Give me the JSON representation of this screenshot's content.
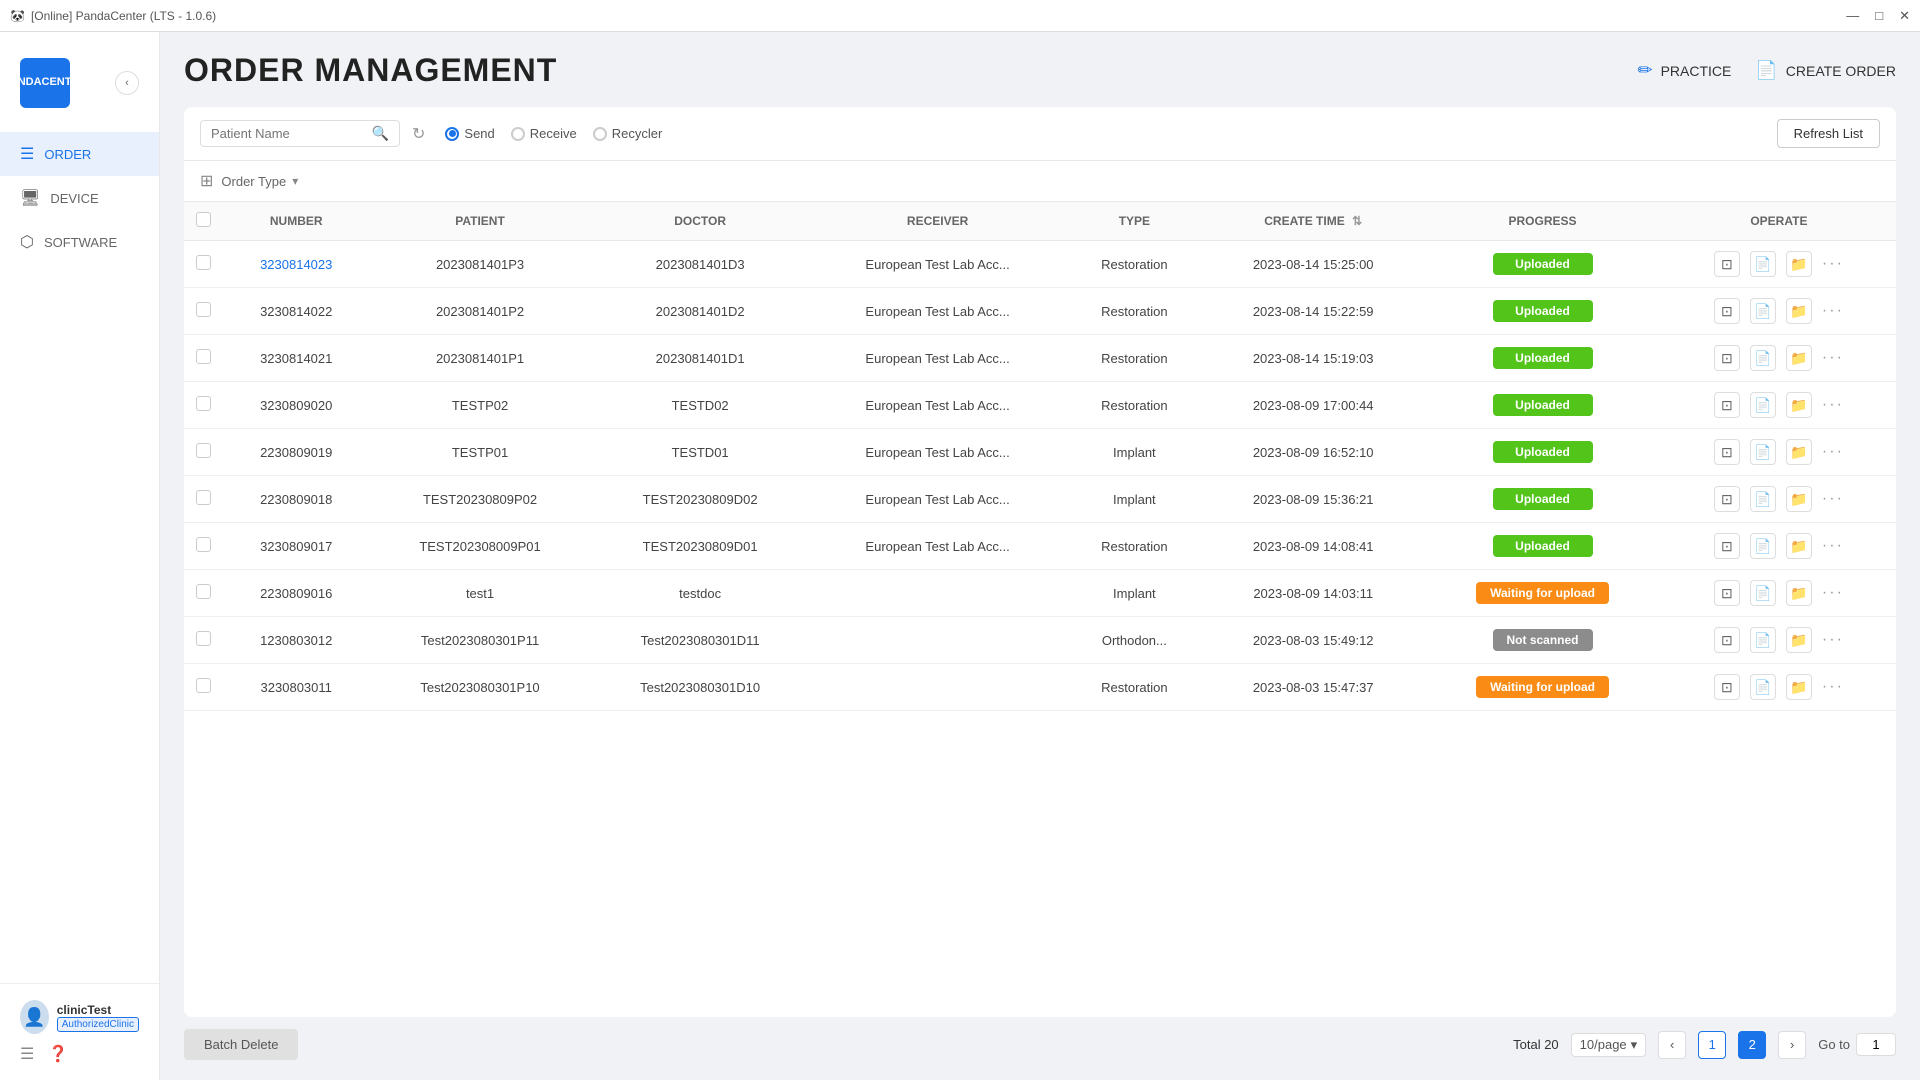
{
  "titlebar": {
    "title": "[Online] PandaCenter (LTS - 1.0.6)",
    "icon": "🐼",
    "buttons": [
      "–",
      "□",
      "✕"
    ]
  },
  "sidebar": {
    "logo": {
      "line1": "PANDA",
      "line2": "CENTER"
    },
    "nav_items": [
      {
        "id": "order",
        "label": "ORDER",
        "icon": "☰",
        "active": true
      },
      {
        "id": "device",
        "label": "DEVICE",
        "icon": "💻",
        "active": false
      },
      {
        "id": "software",
        "label": "SOFTWARE",
        "icon": "⬡",
        "active": false
      }
    ],
    "user": {
      "name": "clinicTest",
      "role": "AuthorizedClinic"
    }
  },
  "header": {
    "title": "ORDER MANAGEMENT",
    "actions": [
      {
        "id": "practice",
        "label": "PRACTICE",
        "icon": "✏"
      },
      {
        "id": "create-order",
        "label": "CREATE ORDER",
        "icon": "📄"
      }
    ]
  },
  "toolbar": {
    "search_placeholder": "Patient Name",
    "radio_options": [
      {
        "id": "send",
        "label": "Send",
        "checked": true
      },
      {
        "id": "receive",
        "label": "Receive",
        "checked": false
      },
      {
        "id": "recycler",
        "label": "Recycler",
        "checked": false
      }
    ],
    "refresh_list_label": "Refresh List",
    "order_type_label": "Order Type"
  },
  "table": {
    "columns": [
      {
        "id": "checkbox",
        "label": ""
      },
      {
        "id": "number",
        "label": "NUMBER"
      },
      {
        "id": "patient",
        "label": "PATIENT"
      },
      {
        "id": "doctor",
        "label": "DOCTOR"
      },
      {
        "id": "receiver",
        "label": "RECEIVER"
      },
      {
        "id": "type",
        "label": "TYPE"
      },
      {
        "id": "create_time",
        "label": "CREATE TIME",
        "sortable": true
      },
      {
        "id": "progress",
        "label": "PROGRESS"
      },
      {
        "id": "operate",
        "label": "OPERATE"
      }
    ],
    "rows": [
      {
        "id": 1,
        "number": "3230814023",
        "patient": "2023081401P3",
        "doctor": "2023081401D3",
        "receiver": "European Test Lab Acc...",
        "type": "Restoration",
        "create_time": "2023-08-14 15:25:00",
        "progress": "Uploaded",
        "progress_type": "uploaded",
        "link": true
      },
      {
        "id": 2,
        "number": "3230814022",
        "patient": "2023081401P2",
        "doctor": "2023081401D2",
        "receiver": "European Test Lab Acc...",
        "type": "Restoration",
        "create_time": "2023-08-14 15:22:59",
        "progress": "Uploaded",
        "progress_type": "uploaded",
        "link": false
      },
      {
        "id": 3,
        "number": "3230814021",
        "patient": "2023081401P1",
        "doctor": "2023081401D1",
        "receiver": "European Test Lab Acc...",
        "type": "Restoration",
        "create_time": "2023-08-14 15:19:03",
        "progress": "Uploaded",
        "progress_type": "uploaded",
        "link": false
      },
      {
        "id": 4,
        "number": "3230809020",
        "patient": "TESTP02",
        "doctor": "TESTD02",
        "receiver": "European Test Lab Acc...",
        "type": "Restoration",
        "create_time": "2023-08-09 17:00:44",
        "progress": "Uploaded",
        "progress_type": "uploaded",
        "link": false
      },
      {
        "id": 5,
        "number": "2230809019",
        "patient": "TESTP01",
        "doctor": "TESTD01",
        "receiver": "European Test Lab Acc...",
        "type": "Implant",
        "create_time": "2023-08-09 16:52:10",
        "progress": "Uploaded",
        "progress_type": "uploaded",
        "link": false
      },
      {
        "id": 6,
        "number": "2230809018",
        "patient": "TEST20230809P02",
        "doctor": "TEST20230809D02",
        "receiver": "European Test Lab Acc...",
        "type": "Implant",
        "create_time": "2023-08-09 15:36:21",
        "progress": "Uploaded",
        "progress_type": "uploaded",
        "link": false
      },
      {
        "id": 7,
        "number": "3230809017",
        "patient": "TEST202308009P01",
        "doctor": "TEST20230809D01",
        "receiver": "European Test Lab Acc...",
        "type": "Restoration",
        "create_time": "2023-08-09 14:08:41",
        "progress": "Uploaded",
        "progress_type": "uploaded",
        "link": false
      },
      {
        "id": 8,
        "number": "2230809016",
        "patient": "test1",
        "doctor": "testdoc",
        "receiver": "",
        "type": "Implant",
        "create_time": "2023-08-09 14:03:11",
        "progress": "Waiting for upload",
        "progress_type": "waiting",
        "link": false
      },
      {
        "id": 9,
        "number": "1230803012",
        "patient": "Test2023080301P11",
        "doctor": "Test2023080301D11",
        "receiver": "",
        "type": "Orthodon...",
        "create_time": "2023-08-03 15:49:12",
        "progress": "Not scanned",
        "progress_type": "not-scanned",
        "link": false
      },
      {
        "id": 10,
        "number": "3230803011",
        "patient": "Test2023080301P10",
        "doctor": "Test2023080301D10",
        "receiver": "",
        "type": "Restoration",
        "create_time": "2023-08-03 15:47:37",
        "progress": "Waiting for upload",
        "progress_type": "waiting",
        "link": false
      }
    ]
  },
  "footer": {
    "batch_delete_label": "Batch Delete",
    "total_label": "Total 20",
    "per_page": "10/page",
    "current_page": 2,
    "pages": [
      1,
      2
    ],
    "goto_label": "Go to",
    "goto_value": "1"
  }
}
